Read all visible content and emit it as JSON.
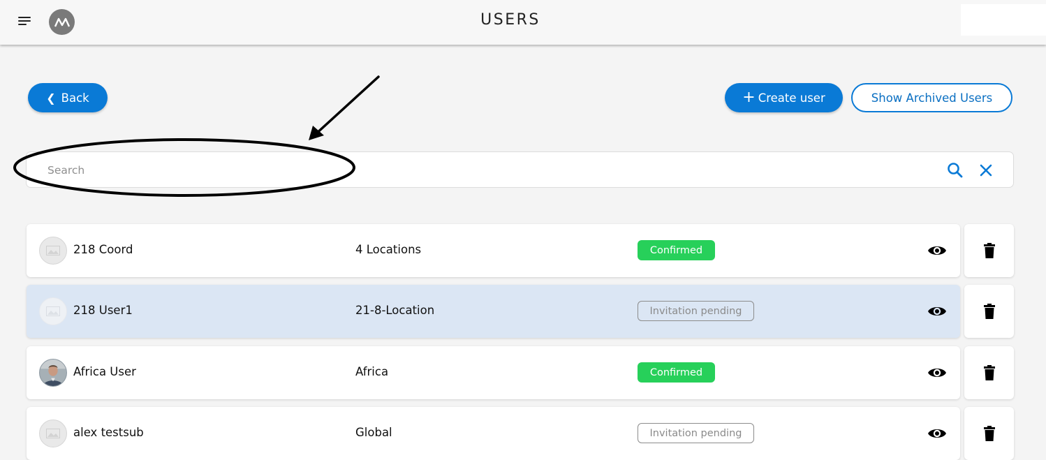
{
  "header": {
    "title": "USERS",
    "logo_letters": "M"
  },
  "toolbar": {
    "back_label": "Back",
    "create_label": "Create user",
    "archived_label": "Show Archived Users"
  },
  "search": {
    "placeholder": "Search",
    "value": ""
  },
  "users": [
    {
      "name": "218 Coord",
      "location": "4 Locations",
      "status": "Confirmed",
      "avatar": "placeholder-image"
    },
    {
      "name": "218 User1",
      "location": "21-8-Location",
      "status": "Invitation pending",
      "avatar": "placeholder-image"
    },
    {
      "name": "Africa User",
      "location": "Africa",
      "status": "Confirmed",
      "avatar": "photo"
    },
    {
      "name": "alex testsub",
      "location": "Global",
      "status": "Invitation pending",
      "avatar": "placeholder-image"
    }
  ],
  "colors": {
    "primary": "#0a7ad6",
    "confirmed": "#27d05a",
    "selected_row": "#dbe6f4"
  },
  "icons": {
    "menu": "hamburger-menu-icon",
    "search": "search-icon",
    "clear": "close-icon",
    "view": "eye-icon",
    "delete": "trash-icon"
  }
}
